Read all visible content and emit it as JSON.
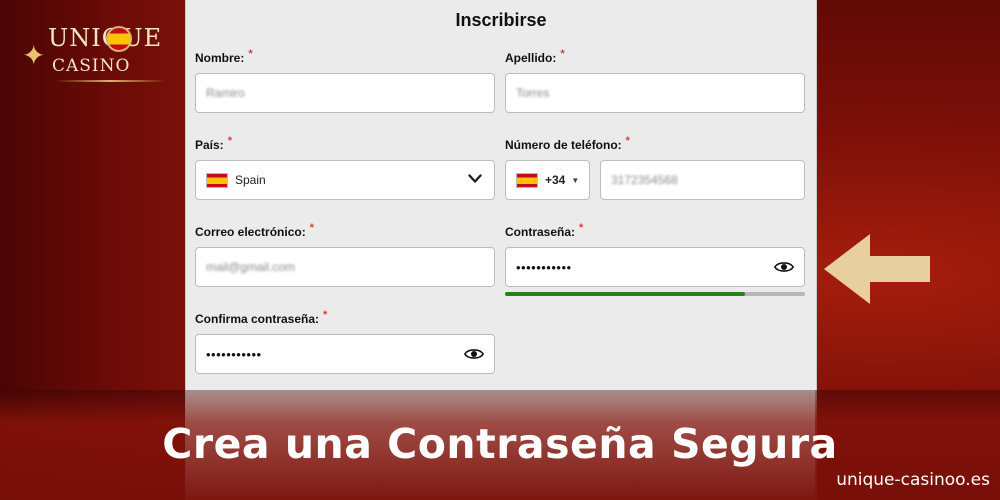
{
  "brand": {
    "logo_top": "UNIQUE",
    "logo_bottom": "CASINO"
  },
  "form": {
    "title": "Inscribirse",
    "required_mark": "*",
    "fields": {
      "first_name": {
        "label": "Nombre:",
        "value": "Ramiro"
      },
      "last_name": {
        "label": "Apellido:",
        "value": "Torres"
      },
      "country": {
        "label": "País:",
        "value": "Spain",
        "icon": "spain-flag-icon"
      },
      "phone": {
        "label": "Número de teléfono:",
        "code": "+34",
        "value": "3172354568"
      },
      "email": {
        "label": "Correo electrónico:",
        "value": "mail@gmail.com"
      },
      "password": {
        "label": "Contraseña:",
        "value": "•••••••••••",
        "strength": 0.8
      },
      "confirm_password": {
        "label": "Confirma contraseña:",
        "value": "•••••••••••"
      }
    }
  },
  "banner": {
    "headline": "Crea una Contraseña Segura",
    "site": "unique-casinoo.es"
  },
  "colors": {
    "background": "#7a0f08",
    "form_background": "#ebebeb",
    "strength_fill": "#2d7d1f",
    "arrow": "#e8cfa0",
    "required": "#e23a3a"
  }
}
